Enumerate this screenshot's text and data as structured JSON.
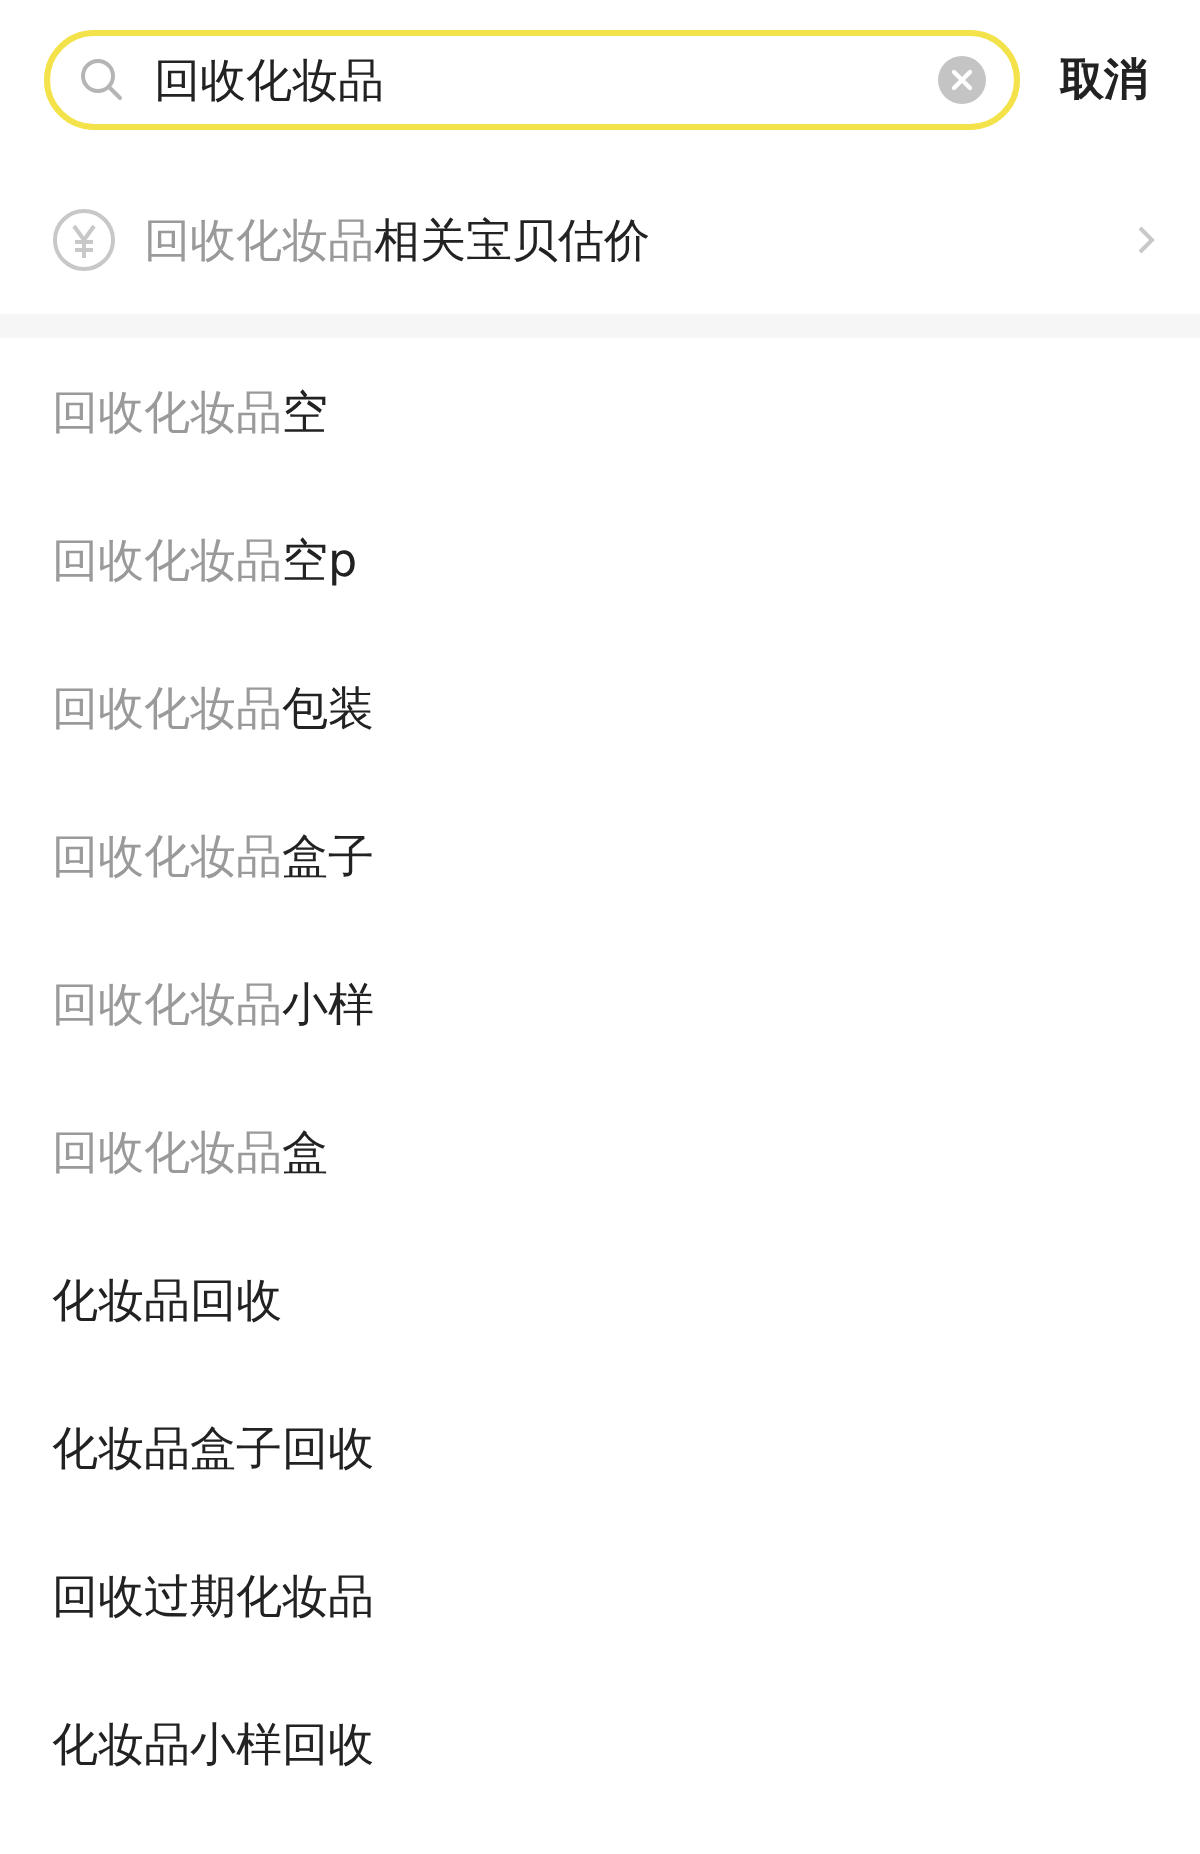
{
  "search": {
    "value": "回收化妆品",
    "cancel": "取消"
  },
  "estimate": {
    "match": "回收化妆品",
    "rest": "相关宝贝估价"
  },
  "suggestions": [
    {
      "match": "回收化妆品",
      "rest": "空"
    },
    {
      "match": "回收化妆品",
      "rest": "空p"
    },
    {
      "match": "回收化妆品",
      "rest": "包装"
    },
    {
      "match": "回收化妆品",
      "rest": "盒子"
    },
    {
      "match": "回收化妆品",
      "rest": "小样"
    },
    {
      "match": "回收化妆品",
      "rest": "盒"
    },
    {
      "rest": "化妆品回收"
    },
    {
      "rest": "化妆品盒子回收"
    },
    {
      "rest": "回收过期化妆品"
    },
    {
      "rest": "化妆品小样回收"
    }
  ]
}
